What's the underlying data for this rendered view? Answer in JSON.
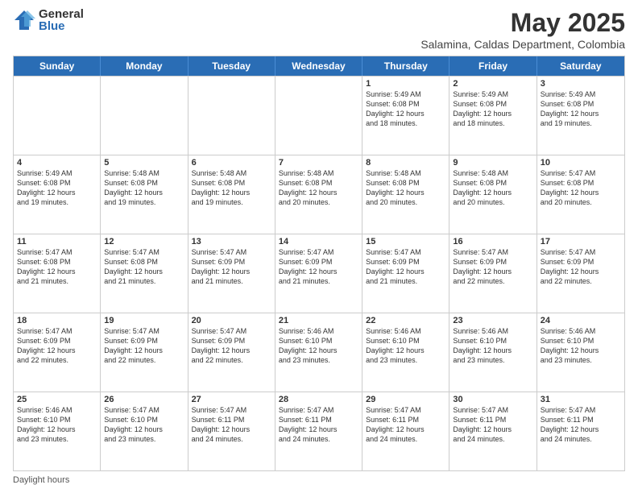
{
  "logo": {
    "general": "General",
    "blue": "Blue"
  },
  "title": "May 2025",
  "subtitle": "Salamina, Caldas Department, Colombia",
  "headers": [
    "Sunday",
    "Monday",
    "Tuesday",
    "Wednesday",
    "Thursday",
    "Friday",
    "Saturday"
  ],
  "footer": "Daylight hours",
  "weeks": [
    [
      {
        "day": "",
        "text": ""
      },
      {
        "day": "",
        "text": ""
      },
      {
        "day": "",
        "text": ""
      },
      {
        "day": "",
        "text": ""
      },
      {
        "day": "1",
        "text": "Sunrise: 5:49 AM\nSunset: 6:08 PM\nDaylight: 12 hours\nand 18 minutes."
      },
      {
        "day": "2",
        "text": "Sunrise: 5:49 AM\nSunset: 6:08 PM\nDaylight: 12 hours\nand 18 minutes."
      },
      {
        "day": "3",
        "text": "Sunrise: 5:49 AM\nSunset: 6:08 PM\nDaylight: 12 hours\nand 19 minutes."
      }
    ],
    [
      {
        "day": "4",
        "text": "Sunrise: 5:49 AM\nSunset: 6:08 PM\nDaylight: 12 hours\nand 19 minutes."
      },
      {
        "day": "5",
        "text": "Sunrise: 5:48 AM\nSunset: 6:08 PM\nDaylight: 12 hours\nand 19 minutes."
      },
      {
        "day": "6",
        "text": "Sunrise: 5:48 AM\nSunset: 6:08 PM\nDaylight: 12 hours\nand 19 minutes."
      },
      {
        "day": "7",
        "text": "Sunrise: 5:48 AM\nSunset: 6:08 PM\nDaylight: 12 hours\nand 20 minutes."
      },
      {
        "day": "8",
        "text": "Sunrise: 5:48 AM\nSunset: 6:08 PM\nDaylight: 12 hours\nand 20 minutes."
      },
      {
        "day": "9",
        "text": "Sunrise: 5:48 AM\nSunset: 6:08 PM\nDaylight: 12 hours\nand 20 minutes."
      },
      {
        "day": "10",
        "text": "Sunrise: 5:47 AM\nSunset: 6:08 PM\nDaylight: 12 hours\nand 20 minutes."
      }
    ],
    [
      {
        "day": "11",
        "text": "Sunrise: 5:47 AM\nSunset: 6:08 PM\nDaylight: 12 hours\nand 21 minutes."
      },
      {
        "day": "12",
        "text": "Sunrise: 5:47 AM\nSunset: 6:08 PM\nDaylight: 12 hours\nand 21 minutes."
      },
      {
        "day": "13",
        "text": "Sunrise: 5:47 AM\nSunset: 6:09 PM\nDaylight: 12 hours\nand 21 minutes."
      },
      {
        "day": "14",
        "text": "Sunrise: 5:47 AM\nSunset: 6:09 PM\nDaylight: 12 hours\nand 21 minutes."
      },
      {
        "day": "15",
        "text": "Sunrise: 5:47 AM\nSunset: 6:09 PM\nDaylight: 12 hours\nand 21 minutes."
      },
      {
        "day": "16",
        "text": "Sunrise: 5:47 AM\nSunset: 6:09 PM\nDaylight: 12 hours\nand 22 minutes."
      },
      {
        "day": "17",
        "text": "Sunrise: 5:47 AM\nSunset: 6:09 PM\nDaylight: 12 hours\nand 22 minutes."
      }
    ],
    [
      {
        "day": "18",
        "text": "Sunrise: 5:47 AM\nSunset: 6:09 PM\nDaylight: 12 hours\nand 22 minutes."
      },
      {
        "day": "19",
        "text": "Sunrise: 5:47 AM\nSunset: 6:09 PM\nDaylight: 12 hours\nand 22 minutes."
      },
      {
        "day": "20",
        "text": "Sunrise: 5:47 AM\nSunset: 6:09 PM\nDaylight: 12 hours\nand 22 minutes."
      },
      {
        "day": "21",
        "text": "Sunrise: 5:46 AM\nSunset: 6:10 PM\nDaylight: 12 hours\nand 23 minutes."
      },
      {
        "day": "22",
        "text": "Sunrise: 5:46 AM\nSunset: 6:10 PM\nDaylight: 12 hours\nand 23 minutes."
      },
      {
        "day": "23",
        "text": "Sunrise: 5:46 AM\nSunset: 6:10 PM\nDaylight: 12 hours\nand 23 minutes."
      },
      {
        "day": "24",
        "text": "Sunrise: 5:46 AM\nSunset: 6:10 PM\nDaylight: 12 hours\nand 23 minutes."
      }
    ],
    [
      {
        "day": "25",
        "text": "Sunrise: 5:46 AM\nSunset: 6:10 PM\nDaylight: 12 hours\nand 23 minutes."
      },
      {
        "day": "26",
        "text": "Sunrise: 5:47 AM\nSunset: 6:10 PM\nDaylight: 12 hours\nand 23 minutes."
      },
      {
        "day": "27",
        "text": "Sunrise: 5:47 AM\nSunset: 6:11 PM\nDaylight: 12 hours\nand 24 minutes."
      },
      {
        "day": "28",
        "text": "Sunrise: 5:47 AM\nSunset: 6:11 PM\nDaylight: 12 hours\nand 24 minutes."
      },
      {
        "day": "29",
        "text": "Sunrise: 5:47 AM\nSunset: 6:11 PM\nDaylight: 12 hours\nand 24 minutes."
      },
      {
        "day": "30",
        "text": "Sunrise: 5:47 AM\nSunset: 6:11 PM\nDaylight: 12 hours\nand 24 minutes."
      },
      {
        "day": "31",
        "text": "Sunrise: 5:47 AM\nSunset: 6:11 PM\nDaylight: 12 hours\nand 24 minutes."
      }
    ]
  ]
}
